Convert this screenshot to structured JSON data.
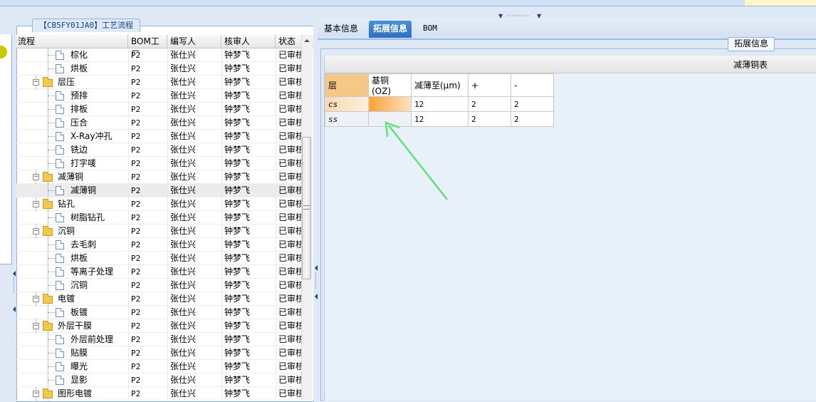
{
  "panel_title": "【CB5FY01JA0】工艺流程",
  "tree": {
    "columns": [
      "流程",
      "BOM工厂",
      "编写人",
      "核审人",
      "状态"
    ],
    "rows": [
      {
        "name": "棕化",
        "type": "doc",
        "factory": "P2",
        "writer": "张仕兴",
        "reviewer": "钟梦飞",
        "status": "已审核"
      },
      {
        "name": "烘板",
        "type": "doc",
        "factory": "P2",
        "writer": "张仕兴",
        "reviewer": "钟梦飞",
        "status": "已审核"
      },
      {
        "name": "层压",
        "type": "folder",
        "factory": "P2",
        "writer": "张仕兴",
        "reviewer": "钟梦飞",
        "status": "已审核"
      },
      {
        "name": "预排",
        "type": "doc",
        "factory": "P2",
        "writer": "张仕兴",
        "reviewer": "钟梦飞",
        "status": "已审核"
      },
      {
        "name": "排板",
        "type": "doc",
        "factory": "P2",
        "writer": "张仕兴",
        "reviewer": "钟梦飞",
        "status": "已审核"
      },
      {
        "name": "压合",
        "type": "doc",
        "factory": "P2",
        "writer": "张仕兴",
        "reviewer": "钟梦飞",
        "status": "已审核"
      },
      {
        "name": "X-Ray冲孔",
        "type": "doc",
        "factory": "P2",
        "writer": "张仕兴",
        "reviewer": "钟梦飞",
        "status": "已审核"
      },
      {
        "name": "铣边",
        "type": "doc",
        "factory": "P2",
        "writer": "张仕兴",
        "reviewer": "钟梦飞",
        "status": "已审核"
      },
      {
        "name": "打字唛",
        "type": "doc",
        "factory": "P2",
        "writer": "张仕兴",
        "reviewer": "钟梦飞",
        "status": "已审核"
      },
      {
        "name": "减薄铜",
        "type": "folder",
        "factory": "P2",
        "writer": "张仕兴",
        "reviewer": "钟梦飞",
        "status": "已审核"
      },
      {
        "name": "减薄铜",
        "type": "doc",
        "factory": "P2",
        "writer": "张仕兴",
        "reviewer": "钟梦飞",
        "status": "已审核",
        "selected": true
      },
      {
        "name": "钻孔",
        "type": "folder",
        "factory": "P2",
        "writer": "张仕兴",
        "reviewer": "钟梦飞",
        "status": "已审核"
      },
      {
        "name": "树脂钻孔",
        "type": "doc",
        "factory": "P2",
        "writer": "张仕兴",
        "reviewer": "钟梦飞",
        "status": "已审核"
      },
      {
        "name": "沉铜",
        "type": "folder",
        "factory": "P2",
        "writer": "张仕兴",
        "reviewer": "钟梦飞",
        "status": "已审核"
      },
      {
        "name": "去毛刺",
        "type": "doc",
        "factory": "P2",
        "writer": "张仕兴",
        "reviewer": "钟梦飞",
        "status": "已审核"
      },
      {
        "name": "烘板",
        "type": "doc",
        "factory": "P2",
        "writer": "张仕兴",
        "reviewer": "钟梦飞",
        "status": "已审核"
      },
      {
        "name": "等离子处理",
        "type": "doc",
        "factory": "P2",
        "writer": "张仕兴",
        "reviewer": "钟梦飞",
        "status": "已审核"
      },
      {
        "name": "沉铜",
        "type": "doc",
        "factory": "P2",
        "writer": "张仕兴",
        "reviewer": "钟梦飞",
        "status": "已审核"
      },
      {
        "name": "电镀",
        "type": "folder",
        "factory": "P2",
        "writer": "张仕兴",
        "reviewer": "钟梦飞",
        "status": "已审核"
      },
      {
        "name": "板镀",
        "type": "doc",
        "factory": "P2",
        "writer": "张仕兴",
        "reviewer": "钟梦飞",
        "status": "已审核"
      },
      {
        "name": "外层干膜",
        "type": "folder",
        "factory": "P2",
        "writer": "张仕兴",
        "reviewer": "钟梦飞",
        "status": "已审核"
      },
      {
        "name": "外层前处理",
        "type": "doc",
        "factory": "P2",
        "writer": "张仕兴",
        "reviewer": "钟梦飞",
        "status": "已审核"
      },
      {
        "name": "贴膜",
        "type": "doc",
        "factory": "P2",
        "writer": "张仕兴",
        "reviewer": "钟梦飞",
        "status": "已审核"
      },
      {
        "name": "曝光",
        "type": "doc",
        "factory": "P2",
        "writer": "张仕兴",
        "reviewer": "钟梦飞",
        "status": "已审核"
      },
      {
        "name": "显影",
        "type": "doc",
        "factory": "P2",
        "writer": "张仕兴",
        "reviewer": "钟梦飞",
        "status": "已审核"
      },
      {
        "name": "图形电镀",
        "type": "folder",
        "factory": "P2",
        "writer": "张仕兴",
        "reviewer": "钟梦飞",
        "status": "已审核"
      }
    ]
  },
  "right_tabs": [
    {
      "label": "基本信息",
      "active": false
    },
    {
      "label": "拓展信息",
      "active": true
    },
    {
      "label": "BOM",
      "active": false
    }
  ],
  "fieldset_legend": "拓展信息",
  "grid_title": "减薄铜表",
  "copper_table": {
    "columns": [
      "层",
      "基铜(OZ)",
      "减薄至(μm)",
      "+",
      "-"
    ],
    "rows": [
      {
        "layer": "cs",
        "base": "",
        "thin_to": "12",
        "plus": "2",
        "minus": "2"
      },
      {
        "layer": "ss",
        "base": "",
        "thin_to": "12",
        "plus": "2",
        "minus": "2"
      }
    ]
  },
  "colors": {
    "accent": "#2f6fc0",
    "arrow": "#5ee07a",
    "selected_cell": "#f9a23a"
  }
}
